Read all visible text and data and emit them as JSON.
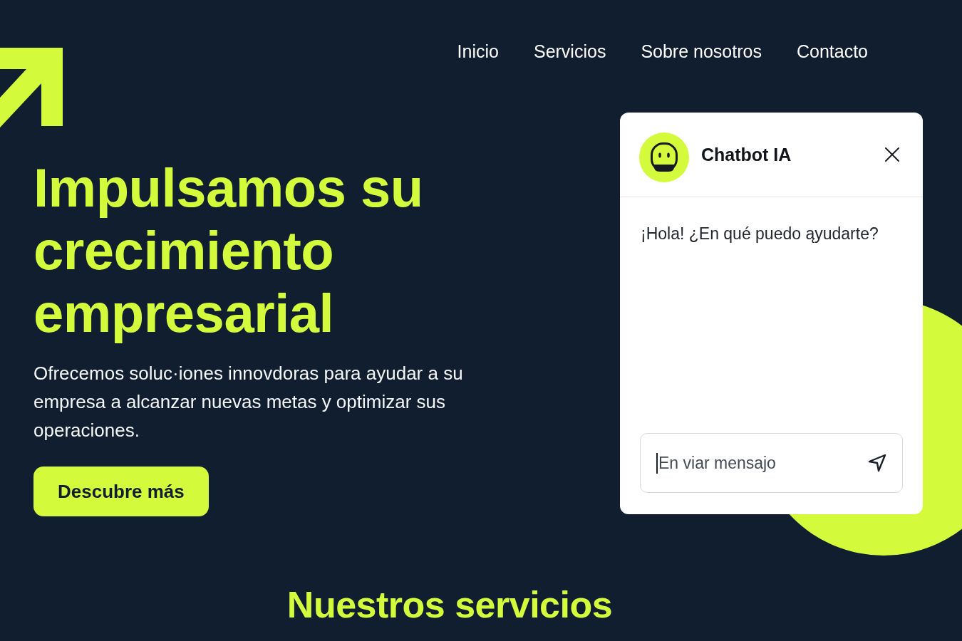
{
  "nav": [
    {
      "label": "Inicio"
    },
    {
      "label": "Servicios"
    },
    {
      "label": "Sobre nosotros"
    },
    {
      "label": "Contacto"
    }
  ],
  "hero": {
    "title": "Impulsamos su crecimiento empresarial",
    "description": "Ofrecemos soluc·iones innovdoras para ayudar a su empresa a alcanzar nuevas metas y optimizar sus operaciones.",
    "button": "Descubre más"
  },
  "chatbot": {
    "title": "Chatbot IA",
    "messages": [
      {
        "text": "¡Hola! ¿En qué puedo ąyudarte?"
      }
    ],
    "input": {
      "placeholder": "En viar mensajo",
      "focused": true
    }
  },
  "services": {
    "title": "Nuestros servicios"
  }
}
